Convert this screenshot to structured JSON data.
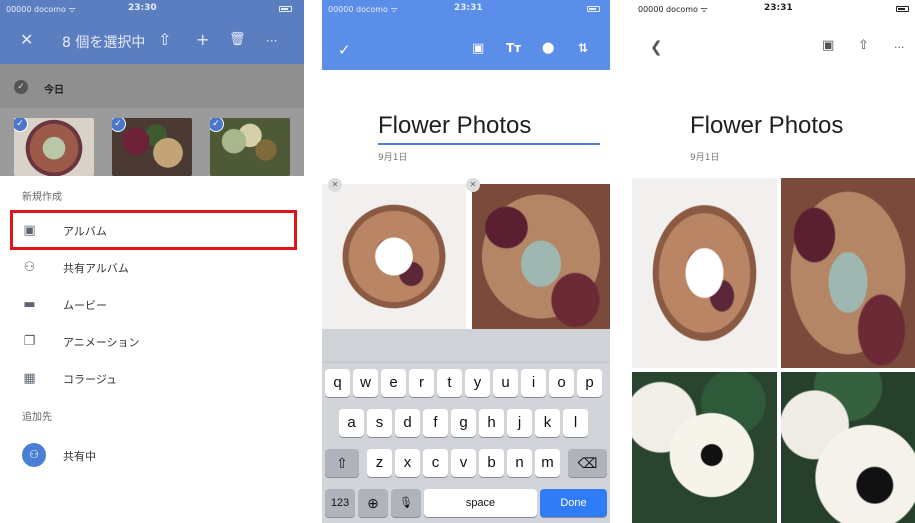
{
  "panel1": {
    "status": {
      "carrier": "00000 docomo ᯤ",
      "time": "23:30"
    },
    "toolbar": {
      "close": "✕",
      "selection_count": "8 個を選択中",
      "share": "⇧",
      "add": "+",
      "delete": "🗑",
      "more": "···"
    },
    "date_label": "今日",
    "create_section": "新規作成",
    "menu": [
      {
        "label": "アルバム",
        "icon": "▣"
      },
      {
        "label": "共有アルバム",
        "icon": "⚇"
      },
      {
        "label": "ムービー",
        "icon": "▬"
      },
      {
        "label": "アニメーション",
        "icon": "❐"
      },
      {
        "label": "コラージュ",
        "icon": "▦"
      }
    ],
    "add_to_section": "追加先",
    "shared": {
      "label": "共有中",
      "icon": "⚇"
    }
  },
  "panel2": {
    "status": {
      "carrier": "00000 docomo ᯤ",
      "time": "23:31"
    },
    "toolbar": {
      "done_check": "✓",
      "add_photo": "▣",
      "text_format": "Tт",
      "location": "⬤",
      "sort": "⇅"
    },
    "album_title": "Flower Photos",
    "album_date": "9月1日",
    "remove": "✕",
    "keyboard": {
      "row1": [
        "q",
        "w",
        "e",
        "r",
        "t",
        "y",
        "u",
        "i",
        "o",
        "p"
      ],
      "row2": [
        "a",
        "s",
        "d",
        "f",
        "g",
        "h",
        "j",
        "k",
        "l"
      ],
      "row3": [
        "z",
        "x",
        "c",
        "v",
        "b",
        "n",
        "m"
      ],
      "shift": "⇧",
      "backspace": "⌫",
      "numbers": "123",
      "globe": "⊕",
      "mic": "🎙",
      "space": "space",
      "done": "Done"
    }
  },
  "panel3": {
    "status": {
      "carrier": "00000 docomo ᯤ",
      "time": "23:31"
    },
    "nav": {
      "back": "❮",
      "add_photo": "▣",
      "share": "⇧",
      "more": "···"
    },
    "album_title": "Flower Photos",
    "album_date": "9月1日"
  },
  "colors": {
    "toolbar_blue": "#5b7ec0",
    "edit_blue": "#5b8ee8",
    "highlight_red": "#e0151b",
    "done_blue": "#2f7cf6"
  }
}
